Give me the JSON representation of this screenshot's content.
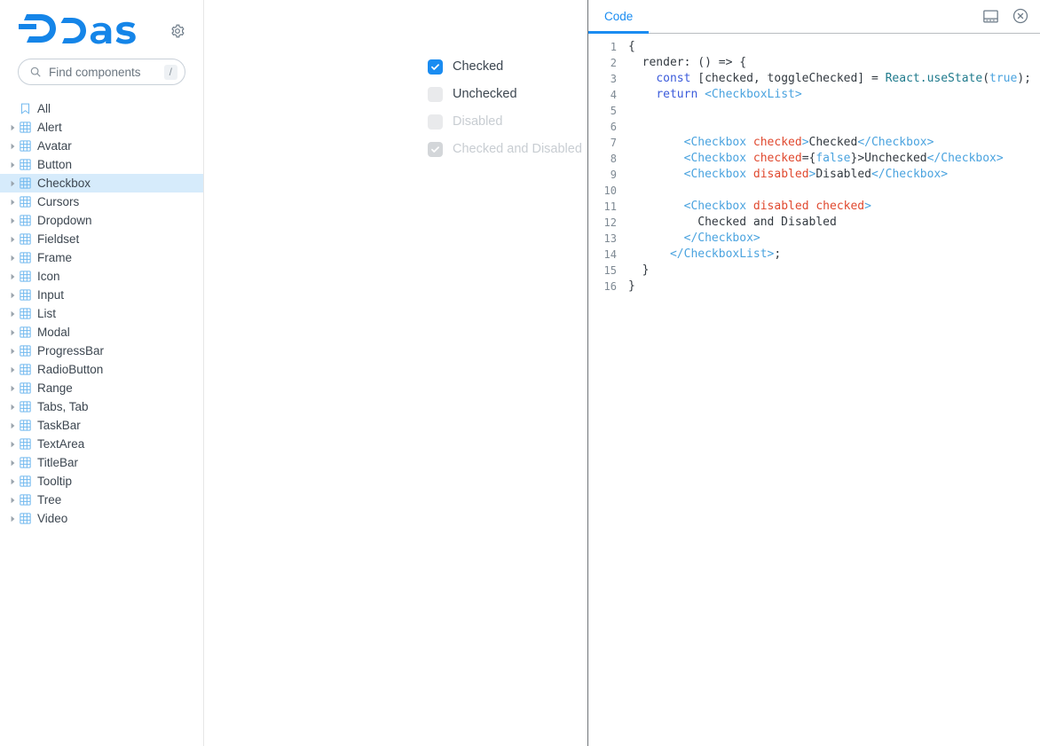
{
  "brand": {
    "name": "Dash",
    "settings_icon": "gear-icon"
  },
  "search": {
    "placeholder": "Find components",
    "value": "",
    "shortcut": "/",
    "icon": "search-icon"
  },
  "sidebar": {
    "items": [
      {
        "label": "All",
        "icon": "bookmark-icon",
        "expandable": false,
        "selected": false
      },
      {
        "label": "Alert",
        "icon": "grid-icon",
        "expandable": true,
        "selected": false
      },
      {
        "label": "Avatar",
        "icon": "grid-icon",
        "expandable": true,
        "selected": false
      },
      {
        "label": "Button",
        "icon": "grid-icon",
        "expandable": true,
        "selected": false
      },
      {
        "label": "Checkbox",
        "icon": "grid-icon",
        "expandable": true,
        "selected": true
      },
      {
        "label": "Cursors",
        "icon": "grid-icon",
        "expandable": true,
        "selected": false
      },
      {
        "label": "Dropdown",
        "icon": "grid-icon",
        "expandable": true,
        "selected": false
      },
      {
        "label": "Fieldset",
        "icon": "grid-icon",
        "expandable": true,
        "selected": false
      },
      {
        "label": "Frame",
        "icon": "grid-icon",
        "expandable": true,
        "selected": false
      },
      {
        "label": "Icon",
        "icon": "grid-icon",
        "expandable": true,
        "selected": false
      },
      {
        "label": "Input",
        "icon": "grid-icon",
        "expandable": true,
        "selected": false
      },
      {
        "label": "List",
        "icon": "grid-icon",
        "expandable": true,
        "selected": false
      },
      {
        "label": "Modal",
        "icon": "grid-icon",
        "expandable": true,
        "selected": false
      },
      {
        "label": "ProgressBar",
        "icon": "grid-icon",
        "expandable": true,
        "selected": false
      },
      {
        "label": "RadioButton",
        "icon": "grid-icon",
        "expandable": true,
        "selected": false
      },
      {
        "label": "Range",
        "icon": "grid-icon",
        "expandable": true,
        "selected": false
      },
      {
        "label": "Tabs, Tab",
        "icon": "grid-icon",
        "expandable": true,
        "selected": false
      },
      {
        "label": "TaskBar",
        "icon": "grid-icon",
        "expandable": true,
        "selected": false
      },
      {
        "label": "TextArea",
        "icon": "grid-icon",
        "expandable": true,
        "selected": false
      },
      {
        "label": "TitleBar",
        "icon": "grid-icon",
        "expandable": true,
        "selected": false
      },
      {
        "label": "Tooltip",
        "icon": "grid-icon",
        "expandable": true,
        "selected": false
      },
      {
        "label": "Tree",
        "icon": "grid-icon",
        "expandable": true,
        "selected": false
      },
      {
        "label": "Video",
        "icon": "grid-icon",
        "expandable": true,
        "selected": false
      }
    ]
  },
  "preview": {
    "checkboxes": [
      {
        "label": "Checked",
        "checked": true,
        "disabled": false
      },
      {
        "label": "Unchecked",
        "checked": false,
        "disabled": false
      },
      {
        "label": "Disabled",
        "checked": false,
        "disabled": true
      },
      {
        "label": "Checked and Disabled",
        "checked": true,
        "disabled": true
      }
    ]
  },
  "code_panel": {
    "tabs": [
      {
        "label": "Code",
        "active": true
      }
    ],
    "actions": [
      {
        "name": "dock-panel-icon",
        "label": ""
      },
      {
        "name": "close-icon",
        "label": ""
      }
    ],
    "lines": [
      {
        "n": "1",
        "tokens": [
          {
            "t": "{",
            "c": "plain"
          }
        ]
      },
      {
        "n": "2",
        "tokens": [
          {
            "t": "  render: () => {",
            "c": "plain"
          }
        ]
      },
      {
        "n": "3",
        "tokens": [
          {
            "t": "    ",
            "c": "plain"
          },
          {
            "t": "const",
            "c": "kw"
          },
          {
            "t": " [checked, toggleChecked] = ",
            "c": "plain"
          },
          {
            "t": "React.useState",
            "c": "obj"
          },
          {
            "t": "(",
            "c": "plain"
          },
          {
            "t": "true",
            "c": "val"
          },
          {
            "t": ");",
            "c": "plain"
          }
        ]
      },
      {
        "n": "4",
        "tokens": [
          {
            "t": "    ",
            "c": "plain"
          },
          {
            "t": "return",
            "c": "kw"
          },
          {
            "t": " ",
            "c": "plain"
          },
          {
            "t": "<CheckboxList>",
            "c": "tag"
          }
        ]
      },
      {
        "n": "5",
        "tokens": [
          {
            "t": "",
            "c": "plain"
          }
        ]
      },
      {
        "n": "6",
        "tokens": [
          {
            "t": "",
            "c": "plain"
          }
        ]
      },
      {
        "n": "7",
        "tokens": [
          {
            "t": "        ",
            "c": "plain"
          },
          {
            "t": "<Checkbox",
            "c": "tag"
          },
          {
            "t": " ",
            "c": "plain"
          },
          {
            "t": "checked",
            "c": "attr"
          },
          {
            "t": ">",
            "c": "tag"
          },
          {
            "t": "Checked",
            "c": "plain"
          },
          {
            "t": "</Checkbox>",
            "c": "tag"
          }
        ]
      },
      {
        "n": "8",
        "tokens": [
          {
            "t": "        ",
            "c": "plain"
          },
          {
            "t": "<Checkbox",
            "c": "tag"
          },
          {
            "t": " ",
            "c": "plain"
          },
          {
            "t": "checked",
            "c": "attr"
          },
          {
            "t": "={",
            "c": "plain"
          },
          {
            "t": "false",
            "c": "val"
          },
          {
            "t": "}>",
            "c": "plain"
          },
          {
            "t": "Unchecked",
            "c": "plain"
          },
          {
            "t": "</Checkbox>",
            "c": "tag"
          }
        ]
      },
      {
        "n": "9",
        "tokens": [
          {
            "t": "        ",
            "c": "plain"
          },
          {
            "t": "<Checkbox",
            "c": "tag"
          },
          {
            "t": " ",
            "c": "plain"
          },
          {
            "t": "disabled",
            "c": "attr"
          },
          {
            "t": ">",
            "c": "tag"
          },
          {
            "t": "Disabled",
            "c": "plain"
          },
          {
            "t": "</Checkbox>",
            "c": "tag"
          }
        ]
      },
      {
        "n": "10",
        "tokens": [
          {
            "t": "",
            "c": "plain"
          }
        ]
      },
      {
        "n": "11",
        "tokens": [
          {
            "t": "        ",
            "c": "plain"
          },
          {
            "t": "<Checkbox",
            "c": "tag"
          },
          {
            "t": " ",
            "c": "plain"
          },
          {
            "t": "disabled checked",
            "c": "attr"
          },
          {
            "t": ">",
            "c": "tag"
          }
        ]
      },
      {
        "n": "12",
        "tokens": [
          {
            "t": "          Checked and Disabled",
            "c": "plain"
          }
        ]
      },
      {
        "n": "13",
        "tokens": [
          {
            "t": "        ",
            "c": "plain"
          },
          {
            "t": "</Checkbox>",
            "c": "tag"
          }
        ]
      },
      {
        "n": "14",
        "tokens": [
          {
            "t": "      ",
            "c": "plain"
          },
          {
            "t": "</CheckboxList>",
            "c": "tag"
          },
          {
            "t": ";",
            "c": "plain"
          }
        ]
      },
      {
        "n": "15",
        "tokens": [
          {
            "t": "  }",
            "c": "plain"
          }
        ]
      },
      {
        "n": "16",
        "tokens": [
          {
            "t": "}",
            "c": "plain"
          }
        ]
      }
    ]
  },
  "colors": {
    "brand_blue": "#1a8cf1",
    "selected_row": "#d6ebfb",
    "tree_icon_blue": "#72b9ef",
    "text": "#3c4650",
    "disabled_text": "#c8cdd2",
    "code_keyword": "#3b5bdb",
    "code_tag": "#4aa3df",
    "code_attr": "#e0492f"
  }
}
